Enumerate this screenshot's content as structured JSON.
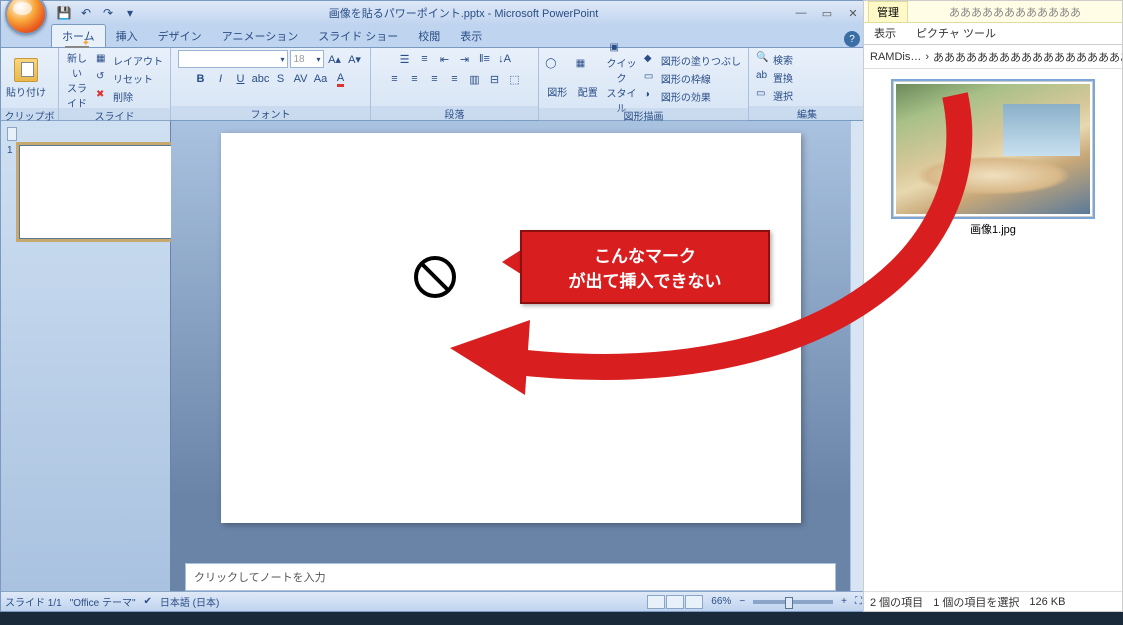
{
  "ppt": {
    "title": "画像を貼るパワーポイント.pptx - Microsoft PowerPoint",
    "qat": {
      "save": "💾",
      "undo": "↶",
      "redo": "↷"
    },
    "tabs": [
      "ホーム",
      "挿入",
      "デザイン",
      "アニメーション",
      "スライド ショー",
      "校閲",
      "表示"
    ],
    "ribbon": {
      "clipboard": {
        "label": "クリップボード",
        "paste": "貼り付け"
      },
      "slides": {
        "label": "スライド",
        "new": "新しい\nスライド",
        "layout": "レイアウト",
        "reset": "リセット",
        "delete": "削除"
      },
      "font": {
        "label": "フォント",
        "size": "18"
      },
      "paragraph": {
        "label": "段落"
      },
      "drawing": {
        "label": "図形描画",
        "shapes": "図形",
        "arrange": "配置",
        "quick": "クイック\nスタイル",
        "fill": "図形の塗りつぶし",
        "outline": "図形の枠線",
        "effects": "図形の効果"
      },
      "editing": {
        "label": "編集",
        "find": "検索",
        "replace": "置換",
        "select": "選択"
      }
    },
    "thumb_number": "1",
    "notes_placeholder": "クリックしてノートを入力",
    "status": {
      "slide": "スライド 1/1",
      "theme": "\"Office テーマ\"",
      "lang": "日本語 (日本)",
      "zoom": "66%"
    }
  },
  "explorer": {
    "tool_tab": "管理",
    "title_placeholder": "ああああああああああああ",
    "tabs": [
      "表示",
      "ピクチャ ツール"
    ],
    "breadcrumb_prefix": "RAMDis…",
    "breadcrumb_sep": "›",
    "breadcrumb_folder": "あああああああああああああああああああああああああああ",
    "file_name": "画像1.jpg",
    "status_items": "2 個の項目",
    "status_selected": "1 個の項目を選択",
    "status_size": "126 KB"
  },
  "annotation": {
    "line1": "こんなマーク",
    "line2": "が出て挿入できない"
  }
}
